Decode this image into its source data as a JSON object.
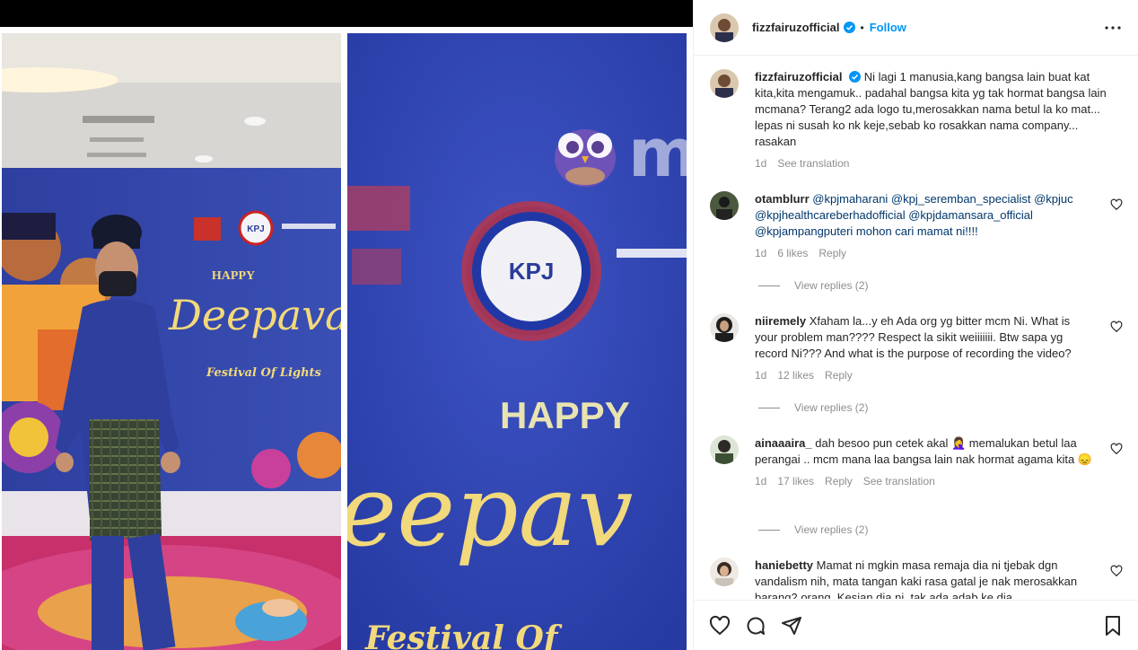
{
  "post": {
    "username": "fizzfairuzofficial",
    "dot": "•",
    "follow_label": "Follow",
    "watermark": "murai"
  },
  "media": {
    "left": {
      "banner_happy": "HAPPY",
      "banner_title": "Deepava",
      "banner_sub": "Festival Of Lights",
      "logo": "KPJ"
    },
    "right": {
      "banner_happy": "HAPPY",
      "banner_title": "eepav",
      "logo": "KPJ",
      "banner_sub": "Festival Of"
    }
  },
  "caption": {
    "username": "fizzfairuzofficial",
    "text": "Ni lagi 1 manusia,kang bangsa lain buat kat kita,kita mengamuk.. padahal bangsa kita yg tak hormat bangsa lain mcmana? Terang2 ada logo tu,merosakkan nama betul la ko mat... lepas ni susah ko nk keje,sebab ko rosakkan nama company... rasakan",
    "time": "1d",
    "see_translation": "See translation"
  },
  "comments": [
    {
      "username": "otamblurr",
      "text": "@kpjmaharani @kpj_seremban_specialist @kpjuc @kpjhealthcareberhadofficial @kpjdamansara_official @kpjampangputeri mohon cari mamat ni!!!!",
      "time": "1d",
      "likes": "6 likes",
      "reply": "Reply",
      "view_replies": "View replies (2)"
    },
    {
      "username": "niiremely",
      "text": "Xfaham la...y eh Ada org yg bitter mcm Ni. What is your problem man???? Respect la sikit weiiiiiii. Btw sapa yg record Ni??? And what is the purpose of recording the video?",
      "time": "1d",
      "likes": "12 likes",
      "reply": "Reply",
      "view_replies": "View replies (2)"
    },
    {
      "username": "ainaaaira_",
      "text": "dah besoo pun cetek akal 🤦‍♀️ memalukan betul laa perangai .. mcm mana laa bangsa lain nak hormat agama kita 😞",
      "time": "1d",
      "likes": "17 likes",
      "reply": "Reply",
      "see_translation": "See translation",
      "view_replies": "View replies (2)"
    },
    {
      "username": "haniebetty",
      "text": "Mamat ni mgkin masa remaja dia ni tjebak dgn vandalism nih, mata tangan kaki rasa gatal je nak merosakkan barang2 orang. Kesian dia ni, tak ada adab ke dia"
    }
  ],
  "icons": {
    "like": "heart-icon",
    "comment": "comment-icon",
    "share": "send-icon",
    "save": "bookmark-icon",
    "more": "more-icon",
    "verified": "verified-badge-icon"
  },
  "colors": {
    "follow": "#0095f6",
    "muted": "#8e8e8e",
    "banner_blue": "#2a3c9a"
  }
}
